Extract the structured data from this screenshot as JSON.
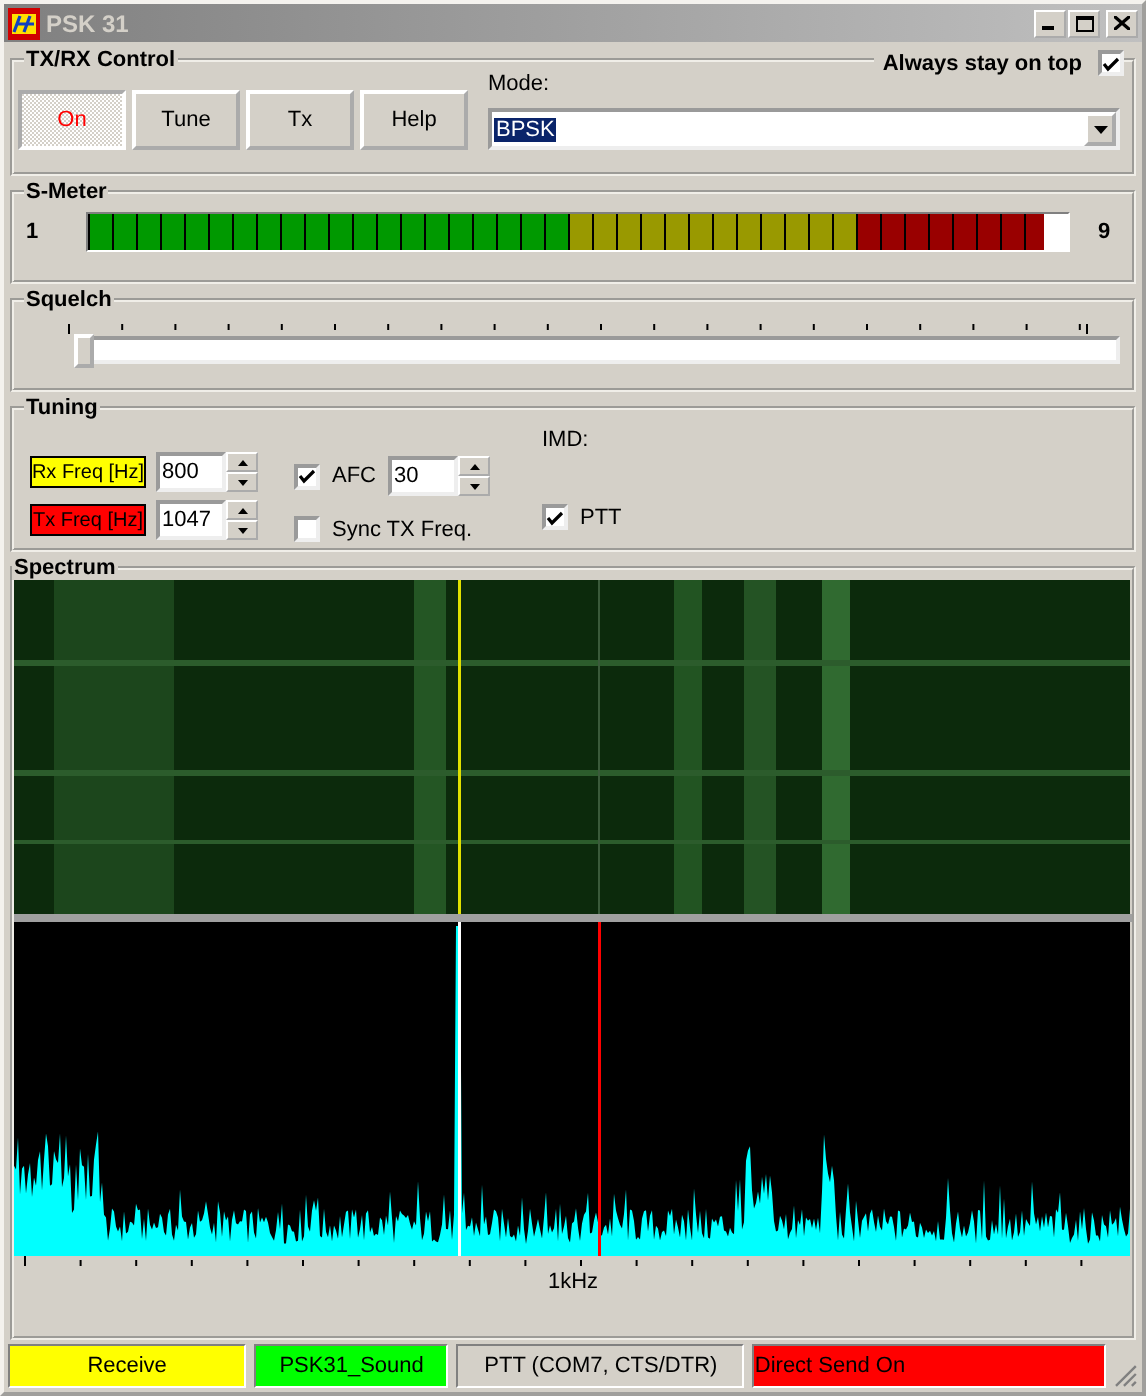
{
  "window": {
    "title": "PSK 31"
  },
  "txrx_control": {
    "title": "TX/RX Control",
    "always_on_top": {
      "label": "Always stay on top",
      "checked": true
    },
    "buttons": [
      {
        "label": "On",
        "active": true
      },
      {
        "label": "Tune",
        "active": false
      },
      {
        "label": "Tx",
        "active": false
      },
      {
        "label": "Help",
        "active": false
      }
    ],
    "mode": {
      "label": "Mode:",
      "value": "BPSK"
    }
  },
  "s_meter": {
    "title": "S-Meter",
    "min_label": "1",
    "max_label": "9",
    "level": 0.976
  },
  "squelch": {
    "title": "Squelch",
    "level": 0
  },
  "tuning": {
    "title": "Tuning",
    "rx_freq": {
      "label": "Rx Freq [Hz]",
      "value": "800"
    },
    "tx_freq": {
      "label": "Tx Freq [Hz]",
      "value": "1047"
    },
    "afc": {
      "label": "AFC",
      "checked": true,
      "value": "30"
    },
    "sync_tx": {
      "label": "Sync TX Freq.",
      "checked": false
    },
    "imd": {
      "label": "IMD:"
    },
    "ptt": {
      "label": "PTT",
      "checked": true
    }
  },
  "spectrum": {
    "title": "Spectrum",
    "axis_label": "1kHz"
  },
  "status_bar": [
    {
      "text": "Receive",
      "color": "#ffff00"
    },
    {
      "text": "PSK31_Sound",
      "color": "#00ff00"
    },
    {
      "text": "PTT (COM7, CTS/DTR)",
      "color": "#d4d0c8"
    },
    {
      "text": "Direct Send On",
      "color": "#ff0000"
    }
  ]
}
